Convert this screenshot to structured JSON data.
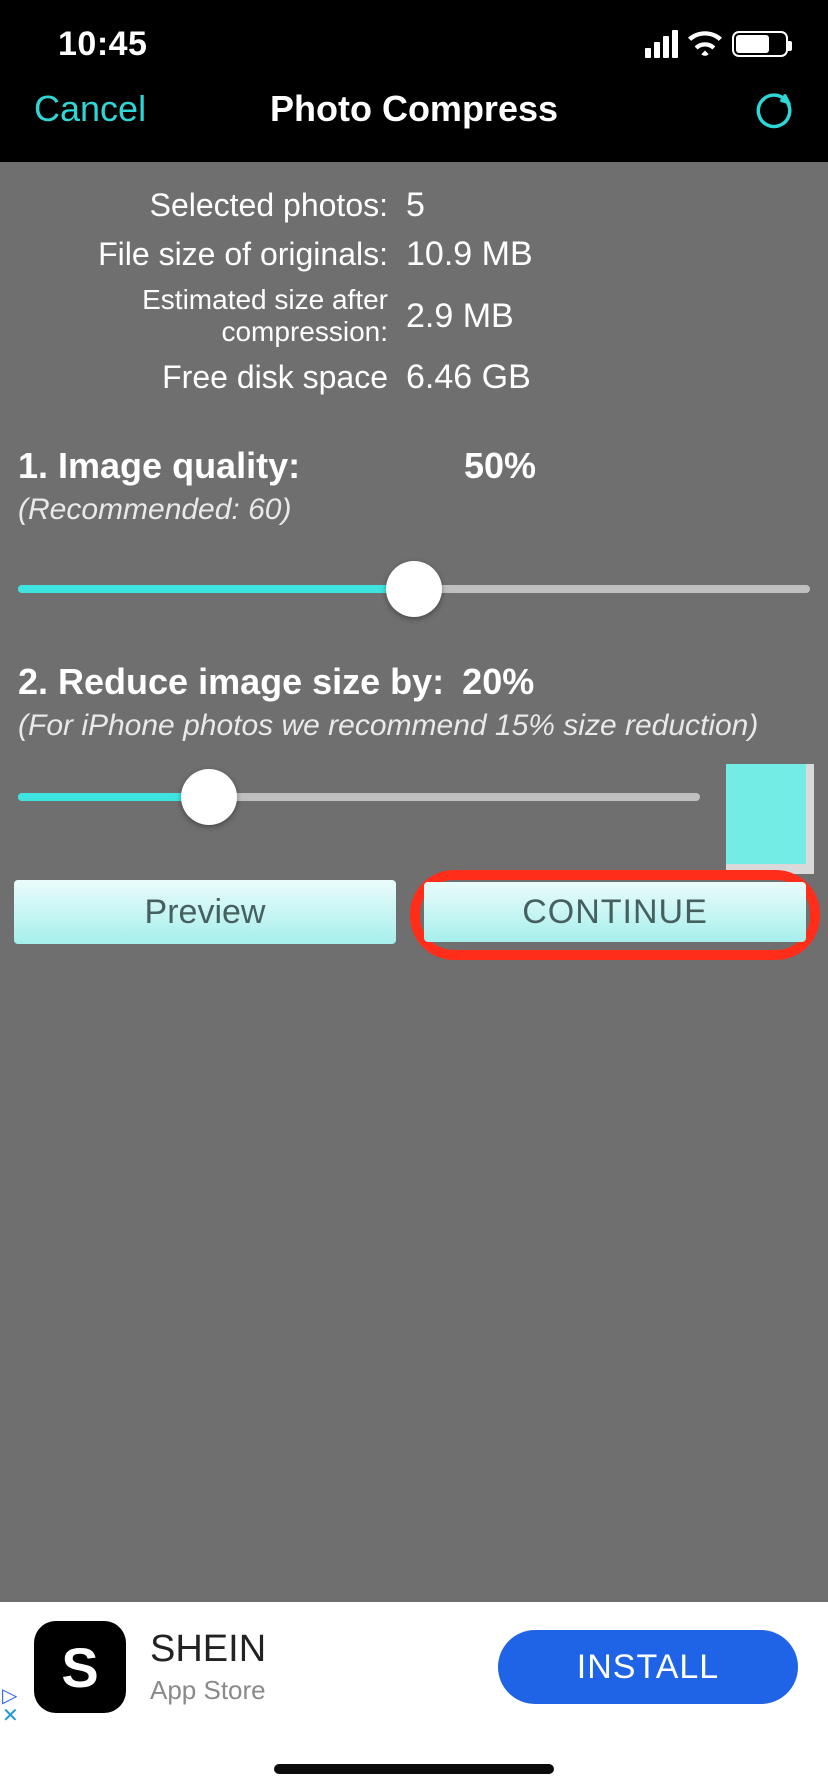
{
  "status": {
    "time": "10:45"
  },
  "nav": {
    "cancel": "Cancel",
    "title": "Photo Compress"
  },
  "stats": {
    "selected_label": "Selected photos:",
    "selected_value": "5",
    "originals_label": "File size of originals:",
    "originals_value": "10.9 MB",
    "estimated_label": "Estimated size after compression:",
    "estimated_value": "2.9 MB",
    "freespace_label": "Free disk space",
    "freespace_value": "6.46 GB"
  },
  "quality": {
    "title": "1. Image quality:",
    "value_label": "50%",
    "recommended": "(Recommended: 60)",
    "percent": 50
  },
  "resize": {
    "title": "2. Reduce image size by:",
    "value_label": "20%",
    "recommended": "(For iPhone photos we recommend 15% size reduction)",
    "percent": 28
  },
  "actions": {
    "preview": "Preview",
    "continue": "CONTINUE"
  },
  "ad": {
    "icon_letter": "S",
    "title": "SHEIN",
    "subtitle": "App Store",
    "cta": "INSTALL"
  }
}
